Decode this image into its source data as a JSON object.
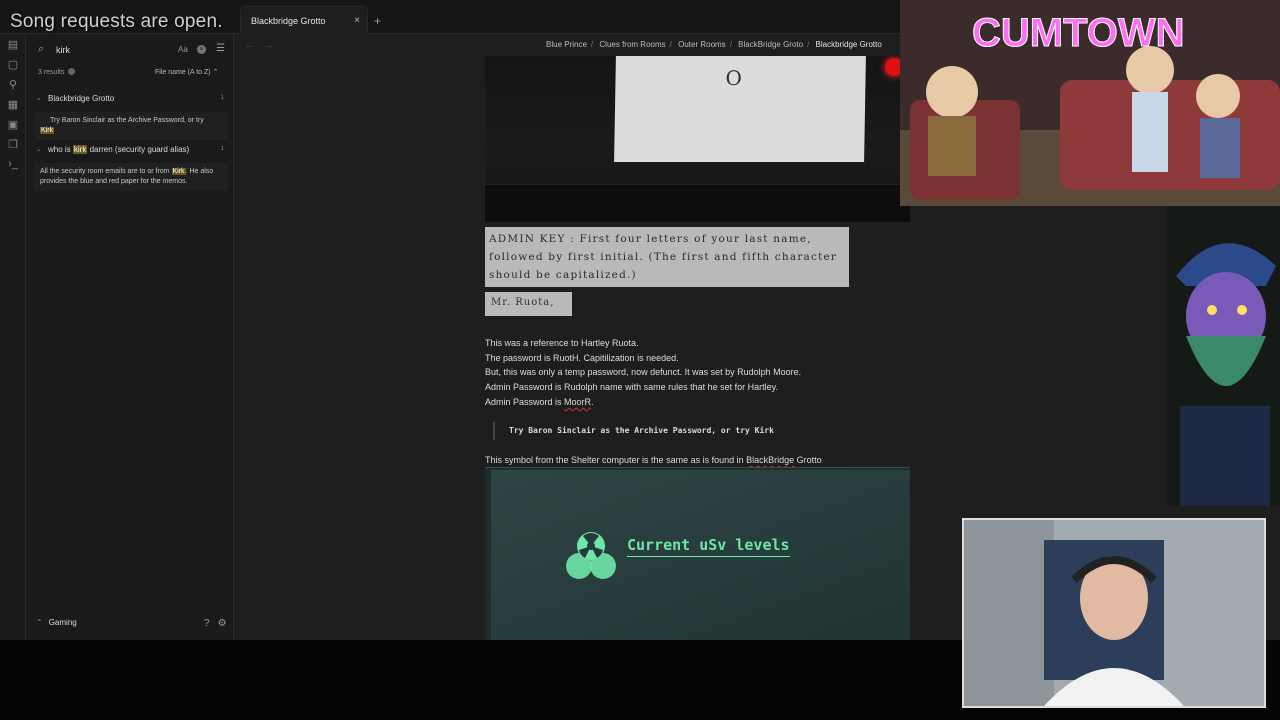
{
  "stream_overlay": {
    "text": "Song requests are open.",
    "cam_title": "CUMTOWN"
  },
  "tab": {
    "label": "Blackbridge Grotto",
    "close": "×",
    "new": "+"
  },
  "search": {
    "query": "kirk",
    "case_toggle": "Aa",
    "results_count": "3 results",
    "sort": "File name (A to Z)",
    "groups": [
      {
        "title": "Blackbridge Grotto",
        "count": "1",
        "match_pre": "Try Baron Sinclair as the Archive Password, or try",
        "match_hl": "Kirk",
        "match_post": ""
      },
      {
        "title_pre": "who is ",
        "title_hl": "kirk",
        "title_post": " darren (security guard alias)",
        "count": "1",
        "match_pre": "All the security room emails are to or from ",
        "match_hl": "Kirk",
        "match_post": ". He also provides the blue and red paper for the memos."
      }
    ]
  },
  "vault": {
    "name": "Gaming"
  },
  "breadcrumb": [
    "Blue Prince",
    "Clues from Rooms",
    "Outer Rooms",
    "BlackBridge Groto",
    "Blackbridge Grotto"
  ],
  "note": {
    "paper_letter": "O",
    "admin_key_text": "ADMIN KEY : First four letters of your last name, followed by first initial. (The first and fifth character should be capitalized.)",
    "signature": "Mr. Ruota,",
    "lines": [
      "This was a reference to Hartley Ruota.",
      "The password is RuotH. Capitilization is needed.",
      "But, this was only a temp password, now defunct. It was set by Rudolph Moore.",
      "Admin Password is Rudolph name with same rules that he set for Hartley."
    ],
    "last_line_pre": "Admin Password is ",
    "last_line_word": "MoorR",
    "last_line_post": ".",
    "code": "Try Baron Sinclair as the Archive Password, or try Kirk",
    "symbol_line_pre": "This symbol from the Shelter computer is the same as is found in ",
    "symbol_line_word": "BlackBridge",
    "symbol_line_post": " Grotto",
    "screen_text": "Current uSv levels"
  }
}
